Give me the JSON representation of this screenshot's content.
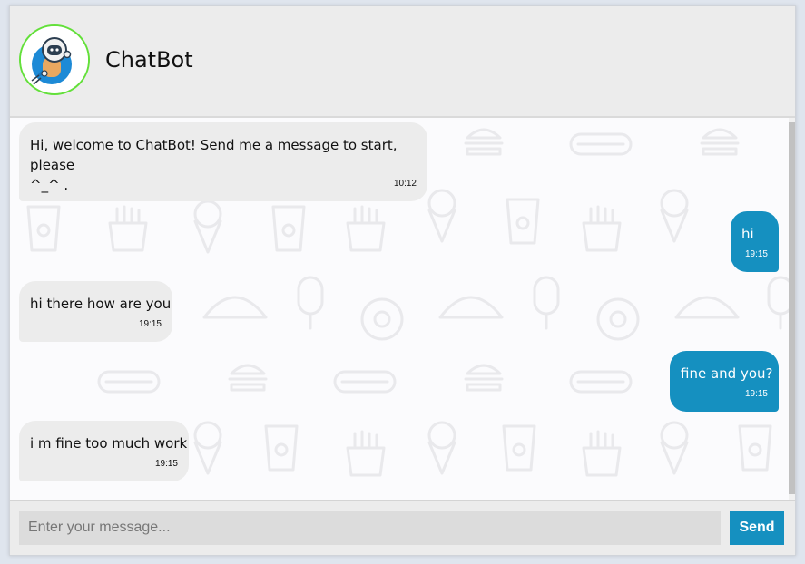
{
  "header": {
    "title": "ChatBot",
    "avatar_icon": "astronaut-bot-avatar"
  },
  "messages": [
    {
      "sender": "bot",
      "lines": [
        "Hi, welcome to ChatBot! Send me a message to start, please",
        "^_^ ."
      ],
      "time": "10:12"
    },
    {
      "sender": "user",
      "text": "hi",
      "time": "19:15"
    },
    {
      "sender": "bot",
      "text": "hi there how are you",
      "time": "19:15"
    },
    {
      "sender": "user",
      "text": "fine and you?",
      "time": "19:15"
    },
    {
      "sender": "bot",
      "text": "i m fine too much work",
      "time": "19:15"
    }
  ],
  "composer": {
    "placeholder": "Enter your message...",
    "send_label": "Send"
  },
  "colors": {
    "accent": "#1590c0",
    "bot_bubble": "#ececec",
    "avatar_ring": "#63e03a"
  },
  "background_pattern_icons": [
    "burger-icon",
    "hotdog-icon",
    "drink-cup-icon",
    "fries-icon",
    "ice-cream-cone-icon",
    "taco-icon",
    "popsicle-icon",
    "donut-icon"
  ]
}
